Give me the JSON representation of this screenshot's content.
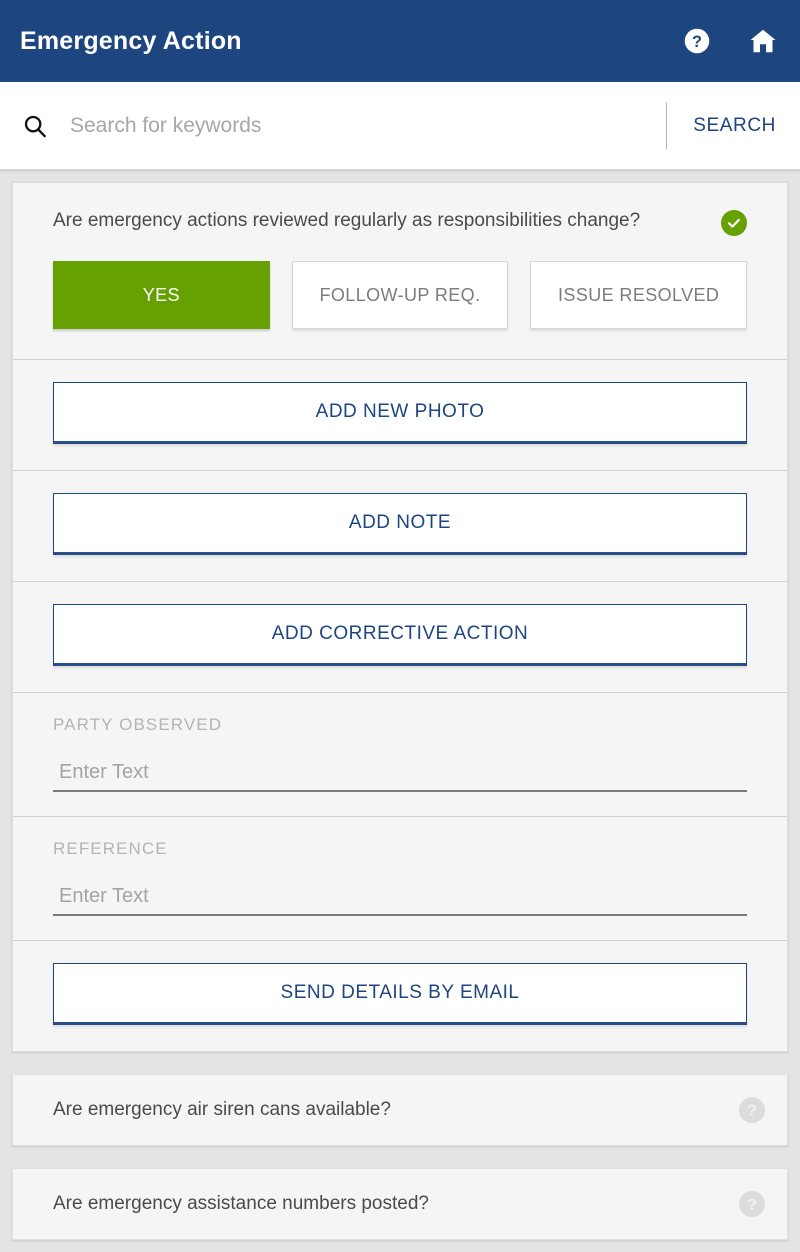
{
  "appbar": {
    "title": "Emergency Action",
    "help_icon": "help-circle-icon",
    "home_icon": "home-icon",
    "background_color": "#1d4580"
  },
  "search": {
    "icon": "search-icon",
    "placeholder": "Search for keywords",
    "value": "",
    "submit_label": "SEARCH"
  },
  "active_question": {
    "text": "Are emergency actions reviewed regularly as responsibilities change?",
    "status_icon": "check-circle-icon",
    "status_color": "#66a003",
    "answers": [
      {
        "label": "YES",
        "state": "selected"
      },
      {
        "label": "FOLLOW-UP REQ.",
        "state": "unselected"
      },
      {
        "label": "ISSUE RESOLVED",
        "state": "unselected"
      }
    ],
    "actions": [
      {
        "label": "ADD NEW PHOTO"
      },
      {
        "label": "ADD NOTE"
      },
      {
        "label": "ADD CORRECTIVE ACTION"
      }
    ],
    "fields": [
      {
        "label": "PARTY OBSERVED",
        "placeholder": "Enter Text",
        "value": ""
      },
      {
        "label": "REFERENCE",
        "placeholder": "Enter Text",
        "value": ""
      }
    ],
    "email_action": {
      "label": "SEND DETAILS BY EMAIL"
    }
  },
  "collapsed_questions": [
    {
      "text": "Are emergency air siren cans available?",
      "status_icon": "help-circle-icon"
    },
    {
      "text": "Are emergency assistance numbers posted?",
      "status_icon": "help-circle-icon"
    }
  ],
  "colors": {
    "brand_blue": "#1d4580",
    "accent_green": "#66a003",
    "page_background": "#e4e4e4",
    "card_background": "#f5f5f5"
  }
}
